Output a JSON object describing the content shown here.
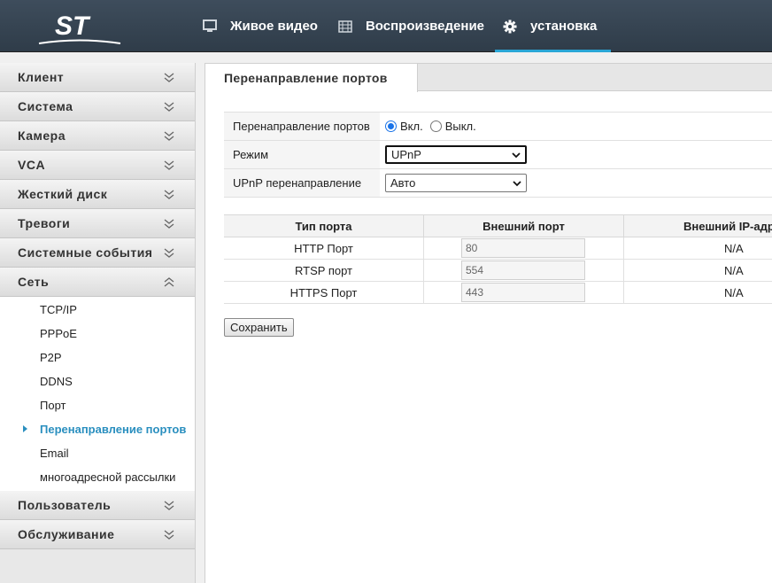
{
  "header": {
    "logo_text": "ST",
    "nav": [
      {
        "label": "Живое видео",
        "icon": "monitor-icon"
      },
      {
        "label": "Воспроизведение",
        "icon": "film-icon"
      },
      {
        "label": "установка",
        "icon": "gear-icon",
        "active": true
      }
    ],
    "accent_color": "#2aa6d6"
  },
  "sidebar": {
    "sections": [
      {
        "label": "Клиент"
      },
      {
        "label": "Система"
      },
      {
        "label": "Камера"
      },
      {
        "label": "VCA"
      },
      {
        "label": "Жесткий диск"
      },
      {
        "label": "Тревоги"
      },
      {
        "label": "Системные события"
      },
      {
        "label": "Сеть",
        "expanded": true
      },
      {
        "label": "Пользователь"
      },
      {
        "label": "Обслуживание"
      }
    ],
    "network_items": [
      {
        "label": "TCP/IP"
      },
      {
        "label": "PPPoE"
      },
      {
        "label": "P2P"
      },
      {
        "label": "DDNS"
      },
      {
        "label": "Порт"
      },
      {
        "label": "Перенаправление портов",
        "active": true
      },
      {
        "label": "Email"
      },
      {
        "label": "многоадресной рассылки"
      }
    ]
  },
  "main": {
    "tab_title": "Перенаправление портов",
    "settings": {
      "port_forwarding_label": "Перенаправление портов",
      "on_label": "Вкл.",
      "off_label": "Выкл.",
      "on_selected": true,
      "mode_label": "Режим",
      "mode_value": "UPnP",
      "upnp_label": "UPnP перенаправление",
      "upnp_value": "Авто"
    },
    "table": {
      "headers": [
        "Тип порта",
        "Внешний порт",
        "Внешний IP-адр"
      ],
      "rows": [
        {
          "type": "HTTP Порт",
          "port": "80",
          "ip": "N/A"
        },
        {
          "type": "RTSP порт",
          "port": "554",
          "ip": "N/A"
        },
        {
          "type": "HTTPS Порт",
          "port": "443",
          "ip": "N/A"
        }
      ]
    },
    "save_label": "Сохранить"
  }
}
